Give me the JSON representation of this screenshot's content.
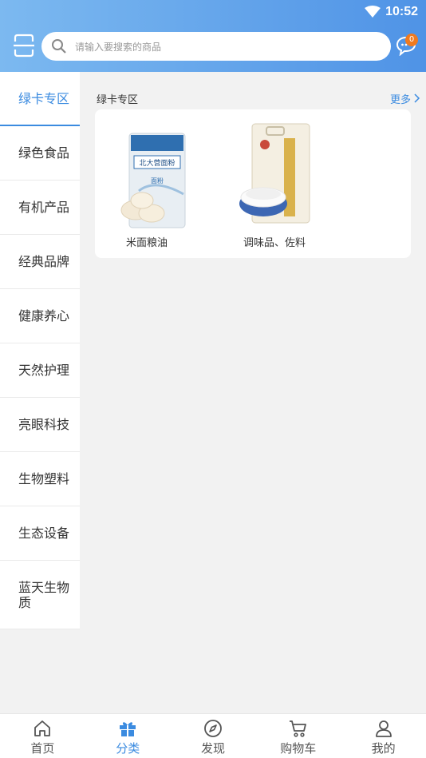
{
  "status": {
    "time": "10:52"
  },
  "search": {
    "placeholder": "请输入要搜索的商品"
  },
  "messages": {
    "badge_count": "0"
  },
  "sidebar": {
    "items": [
      {
        "label": "绿卡专区",
        "active": true
      },
      {
        "label": "绿色食品"
      },
      {
        "label": "有机产品"
      },
      {
        "label": "经典品牌"
      },
      {
        "label": "健康养心"
      },
      {
        "label": "天然护理"
      },
      {
        "label": "亮眼科技"
      },
      {
        "label": "生物塑料"
      },
      {
        "label": "生态设备"
      },
      {
        "label": "蓝天生物质"
      }
    ]
  },
  "section": {
    "title": "绿卡专区",
    "more_label": "更多"
  },
  "products": [
    {
      "name": "米面粮油",
      "bag_text": "北大营面粉",
      "bag_sub": "面粉"
    },
    {
      "name": "调味品、佐料"
    }
  ],
  "tabbar": {
    "items": [
      {
        "label": "首页",
        "icon": "home-icon"
      },
      {
        "label": "分类",
        "icon": "gift-icon",
        "active": true
      },
      {
        "label": "发现",
        "icon": "compass-icon"
      },
      {
        "label": "购物车",
        "icon": "cart-icon"
      },
      {
        "label": "我的",
        "icon": "user-icon"
      }
    ]
  },
  "colors": {
    "accent": "#3b8be0",
    "header_start": "#7cb9f0",
    "header_end": "#4f93e6",
    "badge": "#f07a1e"
  }
}
